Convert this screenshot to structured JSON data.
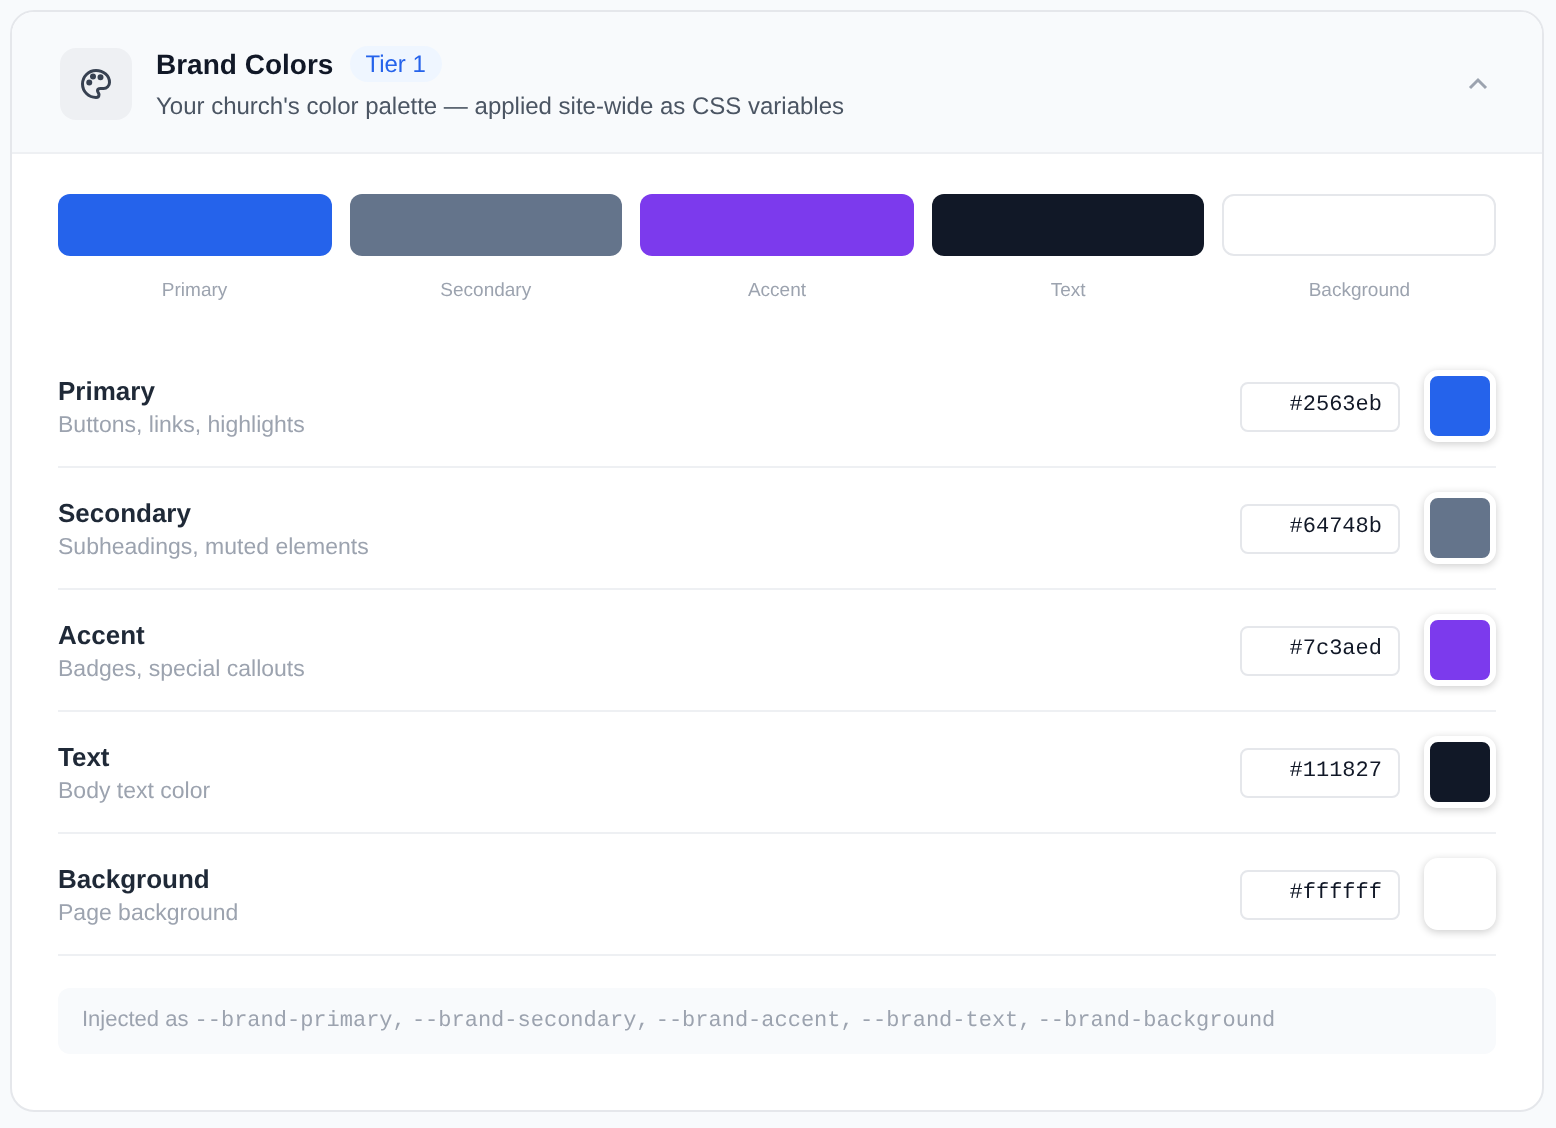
{
  "header": {
    "title": "Brand Colors",
    "badge": "Tier 1",
    "subtitle": "Your church's color palette — applied site-wide as CSS variables",
    "expanded": true
  },
  "swatches": [
    {
      "label": "Primary",
      "color": "#2563eb"
    },
    {
      "label": "Secondary",
      "color": "#64748b"
    },
    {
      "label": "Accent",
      "color": "#7c3aed"
    },
    {
      "label": "Text",
      "color": "#111827"
    },
    {
      "label": "Background",
      "color": "#ffffff"
    }
  ],
  "rows": [
    {
      "name": "Primary",
      "description": "Buttons, links, highlights",
      "value": "#2563eb",
      "color": "#2563eb"
    },
    {
      "name": "Secondary",
      "description": "Subheadings, muted elements",
      "value": "#64748b",
      "color": "#64748b"
    },
    {
      "name": "Accent",
      "description": "Badges, special callouts",
      "value": "#7c3aed",
      "color": "#7c3aed"
    },
    {
      "name": "Text",
      "description": "Body text color",
      "value": "#111827",
      "color": "#111827"
    },
    {
      "name": "Background",
      "description": "Page background",
      "value": "#ffffff",
      "color": "#ffffff"
    }
  ],
  "note": {
    "prefix": "Injected as",
    "variables": [
      "--brand-primary,",
      "--brand-secondary,",
      "--brand-accent,",
      "--brand-text,",
      "--brand-background"
    ]
  }
}
